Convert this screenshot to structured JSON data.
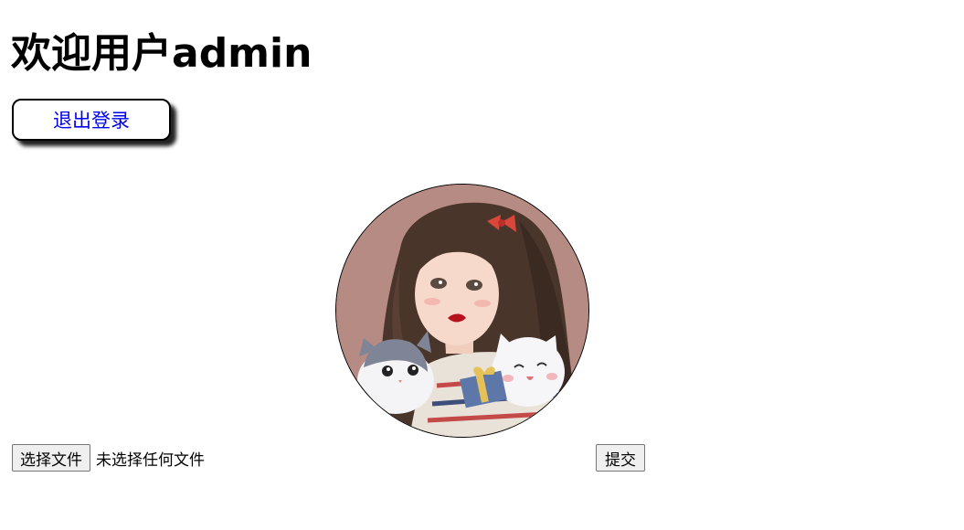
{
  "header": {
    "welcome_text": "欢迎用户admin"
  },
  "actions": {
    "logout_label": "退出登录"
  },
  "avatar": {
    "alt": "avatar"
  },
  "upload": {
    "choose_file_label": "选择文件",
    "no_file_text": "未选择任何文件",
    "submit_label": "提交"
  },
  "colors": {
    "link": "#0000ee",
    "avatar_bg": "#b68b83"
  }
}
